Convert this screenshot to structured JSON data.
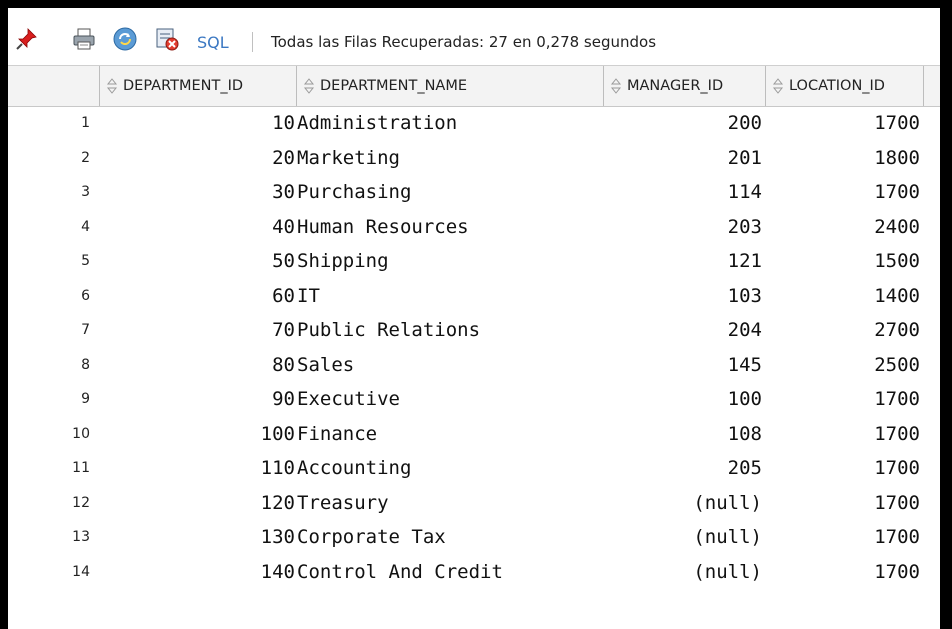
{
  "toolbar": {
    "icons": [
      "pin-icon",
      "print-icon",
      "refresh-icon",
      "export-icon"
    ],
    "sql_label": "SQL",
    "status": "Todas las Filas Recuperadas: 27 en 0,278 segundos"
  },
  "table": {
    "columns": [
      "DEPARTMENT_ID",
      "DEPARTMENT_NAME",
      "MANAGER_ID",
      "LOCATION_ID"
    ],
    "rows": [
      {
        "n": "1",
        "id": "10",
        "name": "Administration",
        "mgr": "200",
        "loc": "1700"
      },
      {
        "n": "2",
        "id": "20",
        "name": "Marketing",
        "mgr": "201",
        "loc": "1800"
      },
      {
        "n": "3",
        "id": "30",
        "name": "Purchasing",
        "mgr": "114",
        "loc": "1700"
      },
      {
        "n": "4",
        "id": "40",
        "name": "Human Resources",
        "mgr": "203",
        "loc": "2400"
      },
      {
        "n": "5",
        "id": "50",
        "name": "Shipping",
        "mgr": "121",
        "loc": "1500"
      },
      {
        "n": "6",
        "id": "60",
        "name": "IT",
        "mgr": "103",
        "loc": "1400"
      },
      {
        "n": "7",
        "id": "70",
        "name": "Public Relations",
        "mgr": "204",
        "loc": "2700"
      },
      {
        "n": "8",
        "id": "80",
        "name": "Sales",
        "mgr": "145",
        "loc": "2500"
      },
      {
        "n": "9",
        "id": "90",
        "name": "Executive",
        "mgr": "100",
        "loc": "1700"
      },
      {
        "n": "10",
        "id": "100",
        "name": "Finance",
        "mgr": "108",
        "loc": "1700"
      },
      {
        "n": "11",
        "id": "110",
        "name": "Accounting",
        "mgr": "205",
        "loc": "1700"
      },
      {
        "n": "12",
        "id": "120",
        "name": "Treasury",
        "mgr": "(null)",
        "loc": "1700"
      },
      {
        "n": "13",
        "id": "130",
        "name": "Corporate Tax",
        "mgr": "(null)",
        "loc": "1700"
      },
      {
        "n": "14",
        "id": "140",
        "name": "Control And Credit",
        "mgr": "(null)",
        "loc": "1700"
      }
    ]
  }
}
